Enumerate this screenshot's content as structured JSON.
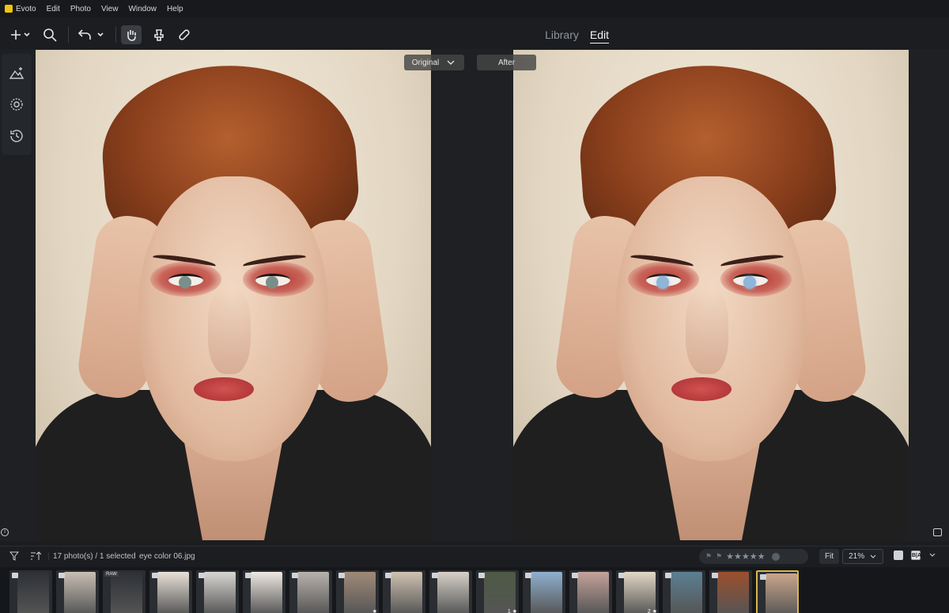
{
  "menu": {
    "app": "Evoto",
    "items": [
      "Edit",
      "Photo",
      "View",
      "Window",
      "Help"
    ]
  },
  "toolbar": {
    "modes": {
      "library": "Library",
      "edit": "Edit"
    },
    "icons": [
      "plus-icon",
      "search-icon",
      "undo-icon",
      "hand-icon",
      "stamp-icon",
      "bandage-icon"
    ]
  },
  "sidebar": {
    "icons": [
      "adjust-icon",
      "filter-icon",
      "history-icon"
    ]
  },
  "compare": {
    "original": "Original",
    "after": "After"
  },
  "filmstrip": {
    "count_text": "17 photo(s) / 1 selected",
    "filename": "eye color 06.jpg",
    "zoom_fit": "Fit",
    "zoom_value": "21%",
    "rating_stars": "★★★★★",
    "thumbs": [
      {
        "tone": "#2d3035",
        "raw": ""
      },
      {
        "tone": "#c8bfb4",
        "raw": ""
      },
      {
        "tone": "#2d3035",
        "raw": "RAW"
      },
      {
        "tone": "#e8e1d7",
        "raw": ""
      },
      {
        "tone": "#d9d6d2",
        "raw": ""
      },
      {
        "tone": "#efe9e2",
        "raw": ""
      },
      {
        "tone": "#b9b2ac",
        "raw": ""
      },
      {
        "tone": "#a08a78",
        "raw": "",
        "badge": "★"
      },
      {
        "tone": "#cfc2b0",
        "raw": ""
      },
      {
        "tone": "#d7d0c8",
        "raw": ""
      },
      {
        "tone": "#4d5a44",
        "raw": "",
        "badge": "1 ★"
      },
      {
        "tone": "#8fb0cf",
        "raw": ""
      },
      {
        "tone": "#c4a29a",
        "raw": ""
      },
      {
        "tone": "#e3d8c6",
        "raw": "",
        "badge": "2 ★"
      },
      {
        "tone": "#5c7f93",
        "raw": ""
      },
      {
        "tone": "#9c4f2d",
        "raw": ""
      },
      {
        "tone": "#caa68b",
        "raw": ""
      }
    ]
  }
}
